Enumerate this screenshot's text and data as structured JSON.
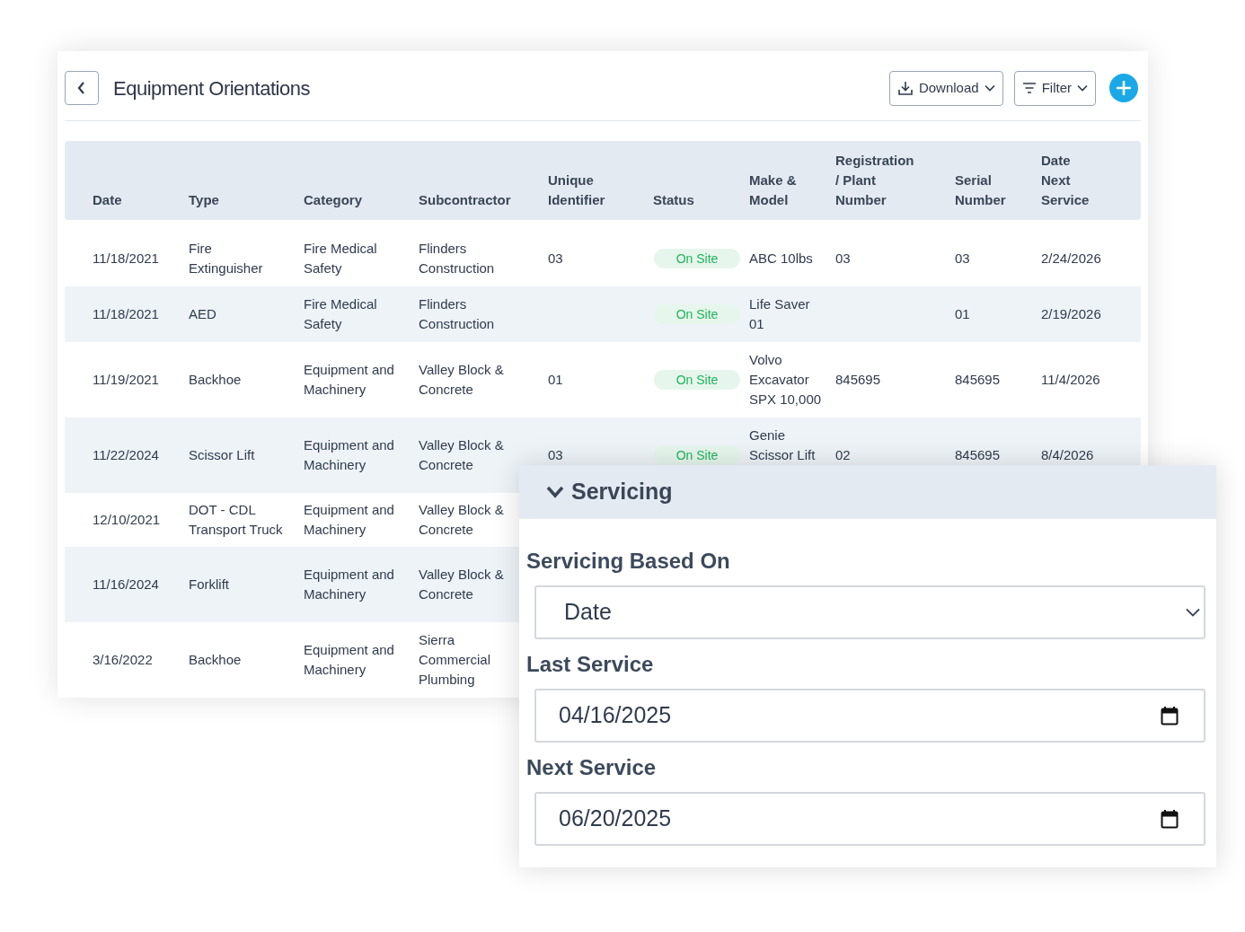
{
  "header": {
    "title": "Equipment Orientations",
    "buttons": [
      {
        "kind": "download",
        "label": "Download"
      },
      {
        "kind": "filter",
        "label": "Filter"
      }
    ]
  },
  "table": {
    "columns": [
      {
        "kind": "text",
        "label": "Date"
      },
      {
        "kind": "text",
        "label": "Type"
      },
      {
        "kind": "text",
        "label": "Category"
      },
      {
        "kind": "text",
        "label": "Subcontractor"
      },
      {
        "kind": "text",
        "label": "Unique\nIdentifier"
      },
      {
        "kind": "badge",
        "label": "Status"
      },
      {
        "kind": "text",
        "label": "Make &\nModel"
      },
      {
        "kind": "text",
        "label": "Registration\n/ Plant\nNumber"
      },
      {
        "kind": "text",
        "label": "Serial\nNumber"
      },
      {
        "kind": "text",
        "label": "Date\nNext\nService"
      }
    ],
    "rows": [
      {
        "cells": [
          "11/18/2021",
          "Fire\nExtinguisher",
          "Fire Medical\nSafety",
          "Flinders\nConstruction",
          "03",
          "On Site",
          "ABC 10lbs",
          "03",
          "03",
          "2/24/2026"
        ]
      },
      {
        "cells": [
          "11/18/2021",
          "AED",
          "Fire Medical\nSafety",
          "Flinders\nConstruction",
          null,
          "On Site",
          "Life Saver\n01",
          null,
          "01",
          "2/19/2026"
        ]
      },
      {
        "cells": [
          "11/19/2021",
          "Backhoe",
          "Equipment and\nMachinery",
          "Valley Block &\nConcrete",
          "01",
          "On Site",
          "Volvo\nExcavator\nSPX 10,000",
          "845695",
          "845695",
          "11/4/2026"
        ]
      },
      {
        "cells": [
          "11/22/2024",
          "Scissor Lift",
          "Equipment and\nMachinery",
          "Valley Block &\nConcrete",
          "03",
          "On Site",
          "Genie\nScissor Lift",
          "02",
          "845695",
          "8/4/2026"
        ]
      },
      {
        "cells": [
          "12/10/2021",
          "DOT - CDL\nTransport Truck",
          "Equipment and\nMachinery",
          "Valley Block &\nConcrete"
        ]
      },
      {
        "cells": [
          "11/16/2024",
          "Forklift",
          "Equipment and\nMachinery",
          "Valley Block &\nConcrete"
        ]
      },
      {
        "cells": [
          "3/16/2022",
          "Backhoe",
          "Equipment and\nMachinery",
          "Sierra\nCommercial\nPlumbing"
        ]
      }
    ]
  },
  "servicing_panel": {
    "title": "Servicing",
    "expanded": true,
    "fields": [
      {
        "kind": "select",
        "label": "Servicing Based On",
        "value": "Date"
      },
      {
        "kind": "date",
        "label": "Last Service",
        "value": "04/16/2025"
      },
      {
        "kind": "date",
        "label": "Next Service",
        "value": "06/20/2025"
      }
    ]
  }
}
